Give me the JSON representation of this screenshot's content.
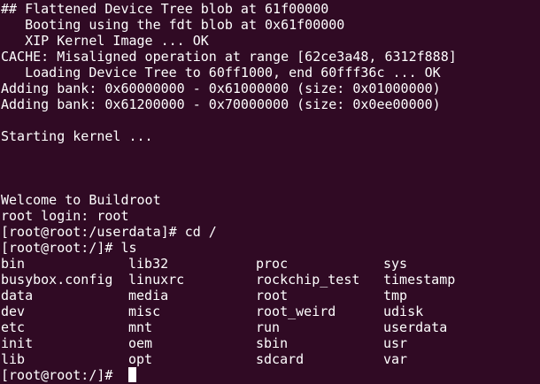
{
  "colors": {
    "background": "#300a24",
    "foreground": "#ffffff",
    "cursor": "#ffffff"
  },
  "boot_lines": [
    "## Flattened Device Tree blob at 61f00000",
    "   Booting using the fdt blob at 0x61f00000",
    "   XIP Kernel Image ... OK",
    "CACHE: Misaligned operation at range [62ce3a48, 6312f888]",
    "   Loading Device Tree to 60ff1000, end 60fff36c ... OK",
    "Adding bank: 0x60000000 - 0x61000000 (size: 0x01000000)",
    "Adding bank: 0x61200000 - 0x70000000 (size: 0x0ee00000)",
    "",
    "Starting kernel ...",
    "",
    "",
    "",
    "Welcome to Buildroot",
    "root login: root",
    "[root@root:/userdata]# cd /",
    "[root@root:/]# ls"
  ],
  "ls_rows": [
    [
      "bin",
      "lib32",
      "proc",
      "sys"
    ],
    [
      "busybox.config",
      "linuxrc",
      "rockchip_test",
      "timestamp"
    ],
    [
      "data",
      "media",
      "root",
      "tmp"
    ],
    [
      "dev",
      "misc",
      "root_weird",
      "udisk"
    ],
    [
      "etc",
      "mnt",
      "run",
      "userdata"
    ],
    [
      "init",
      "oem",
      "sbin",
      "usr"
    ],
    [
      "lib",
      "opt",
      "sdcard",
      "var"
    ]
  ],
  "final_prompt": "[root@root:/]# "
}
